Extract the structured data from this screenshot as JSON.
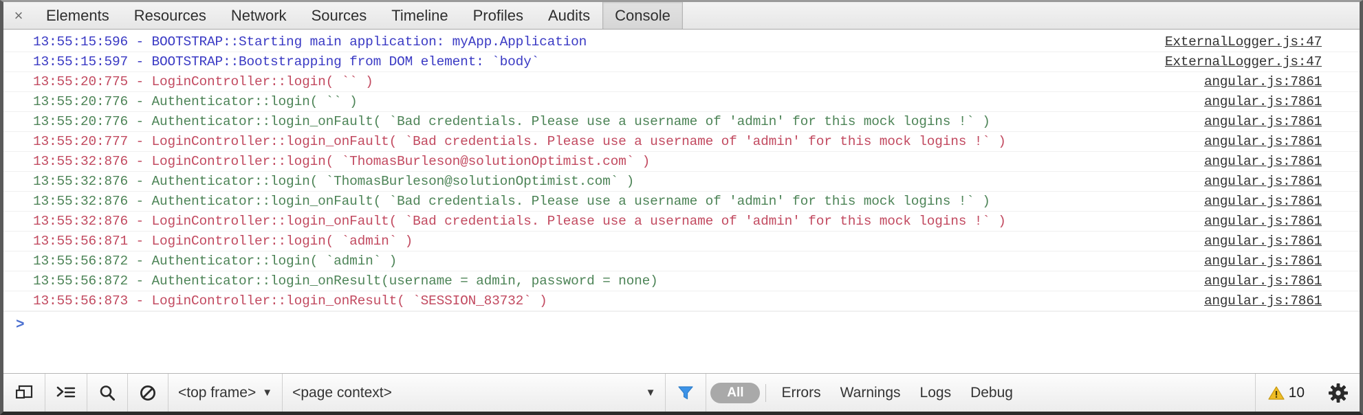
{
  "window": {
    "close_label": "×"
  },
  "toolbar": {
    "tabs": [
      {
        "label": "Elements",
        "selected": false
      },
      {
        "label": "Resources",
        "selected": false
      },
      {
        "label": "Network",
        "selected": false
      },
      {
        "label": "Sources",
        "selected": false
      },
      {
        "label": "Timeline",
        "selected": false
      },
      {
        "label": "Profiles",
        "selected": false
      },
      {
        "label": "Audits",
        "selected": false
      },
      {
        "label": "Console",
        "selected": true
      }
    ]
  },
  "console": {
    "prompt_symbol": ">",
    "prompt_value": "",
    "colors": {
      "info": "#3a3ac4",
      "error": "#c24a60",
      "ok": "#4d8457",
      "link": "#333333"
    },
    "rows": [
      {
        "message": "13:55:15:596 - BOOTSTRAP::Starting main application: myApp.Application",
        "source": "ExternalLogger.js:47",
        "level": "info"
      },
      {
        "message": "13:55:15:597 - BOOTSTRAP::Bootstrapping from DOM element: `body`",
        "source": "ExternalLogger.js:47",
        "level": "info"
      },
      {
        "message": "13:55:20:775 - LoginController::login( `` )",
        "source": "angular.js:7861",
        "level": "error"
      },
      {
        "message": "13:55:20:776 - Authenticator::login( `` )",
        "source": "angular.js:7861",
        "level": "ok"
      },
      {
        "message": "13:55:20:776 - Authenticator::login_onFault( `Bad credentials. Please use a username of 'admin' for this mock logins !` )",
        "source": "angular.js:7861",
        "level": "ok"
      },
      {
        "message": "13:55:20:777 - LoginController::login_onFault( `Bad credentials. Please use a username of 'admin' for this mock logins !` )",
        "source": "angular.js:7861",
        "level": "error"
      },
      {
        "message": "13:55:32:876 - LoginController::login( `ThomasBurleson@solutionOptimist.com` )",
        "source": "angular.js:7861",
        "level": "error"
      },
      {
        "message": "13:55:32:876 - Authenticator::login( `ThomasBurleson@solutionOptimist.com` )",
        "source": "angular.js:7861",
        "level": "ok"
      },
      {
        "message": "13:55:32:876 - Authenticator::login_onFault( `Bad credentials. Please use a username of 'admin' for this mock logins !` )",
        "source": "angular.js:7861",
        "level": "ok"
      },
      {
        "message": "13:55:32:876 - LoginController::login_onFault( `Bad credentials. Please use a username of 'admin' for this mock logins !` )",
        "source": "angular.js:7861",
        "level": "error"
      },
      {
        "message": "13:55:56:871 - LoginController::login( `admin` )",
        "source": "angular.js:7861",
        "level": "error"
      },
      {
        "message": "13:55:56:872 - Authenticator::login( `admin` )",
        "source": "angular.js:7861",
        "level": "ok"
      },
      {
        "message": "13:55:56:872 - Authenticator::login_onResult(username = admin, password = none)",
        "source": "angular.js:7861",
        "level": "ok"
      },
      {
        "message": "13:55:56:873 - LoginController::login_onResult( `SESSION_83732` )",
        "source": "angular.js:7861",
        "level": "error"
      }
    ]
  },
  "statusbar": {
    "dock_icon": "dock-panel-icon",
    "console_icon": "show-console-drawer-icon",
    "search_icon": "search-icon",
    "clear_icon": "clear-console-icon",
    "frame_selector": "<top frame>",
    "context_selector": "<page context>",
    "filter_icon": "filter-funnel-icon",
    "level_all": "All",
    "levels": [
      "Errors",
      "Warnings",
      "Logs",
      "Debug"
    ],
    "warning_icon": "warning-triangle-icon",
    "warning_count": "10",
    "settings_icon": "gear-icon"
  }
}
